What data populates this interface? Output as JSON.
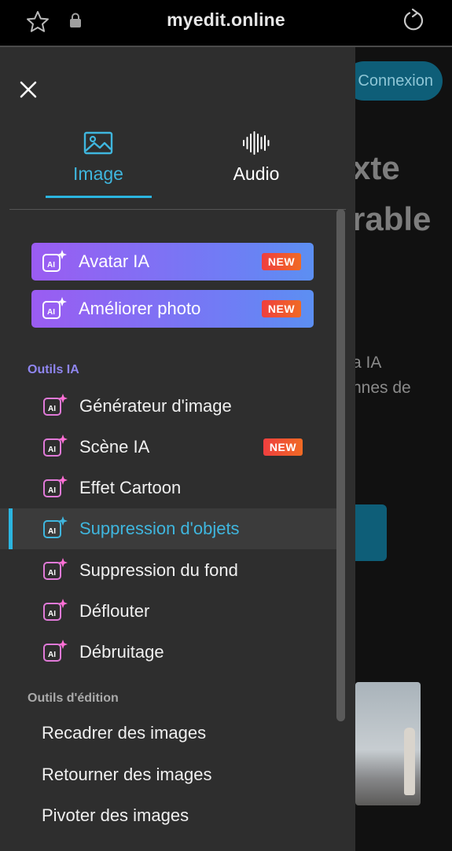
{
  "browser": {
    "url": "myedit.online"
  },
  "background_page": {
    "connexion_label": "Connexion",
    "heading_line1": "xte",
    "heading_line2": "rable",
    "text_line1": "a IA",
    "text_line2": "nnes de"
  },
  "drawer": {
    "tabs": [
      {
        "label": "Image",
        "icon": "image-icon",
        "active": true
      },
      {
        "label": "Audio",
        "icon": "audio-wave-icon",
        "active": false
      }
    ],
    "promos": [
      {
        "label": "Avatar IA",
        "badge": "NEW"
      },
      {
        "label": "Améliorer photo",
        "badge": "NEW"
      }
    ],
    "sections": {
      "ai_tools_title": "Outils IA",
      "edit_tools_title": "Outils d'édition"
    },
    "ai_tools": [
      {
        "label": "Générateur d'image",
        "badge": ""
      },
      {
        "label": "Scène IA",
        "badge": "NEW"
      },
      {
        "label": "Effet Cartoon",
        "badge": ""
      },
      {
        "label": "Suppression d'objets",
        "badge": "",
        "active": true
      },
      {
        "label": "Suppression du fond",
        "badge": ""
      },
      {
        "label": "Déflouter",
        "badge": ""
      },
      {
        "label": "Débruitage",
        "badge": ""
      }
    ],
    "edit_tools": [
      {
        "label": "Recadrer des images"
      },
      {
        "label": "Retourner des images"
      },
      {
        "label": "Pivoter des images"
      }
    ]
  },
  "colors": {
    "accent": "#2bb5e0",
    "drawer_bg": "#2e2e2e",
    "promo_gradient_start": "#9b5cf2",
    "promo_gradient_end": "#5c8ff2",
    "badge_red": "#ef3f3f",
    "section_ia": "#8f86f0"
  }
}
